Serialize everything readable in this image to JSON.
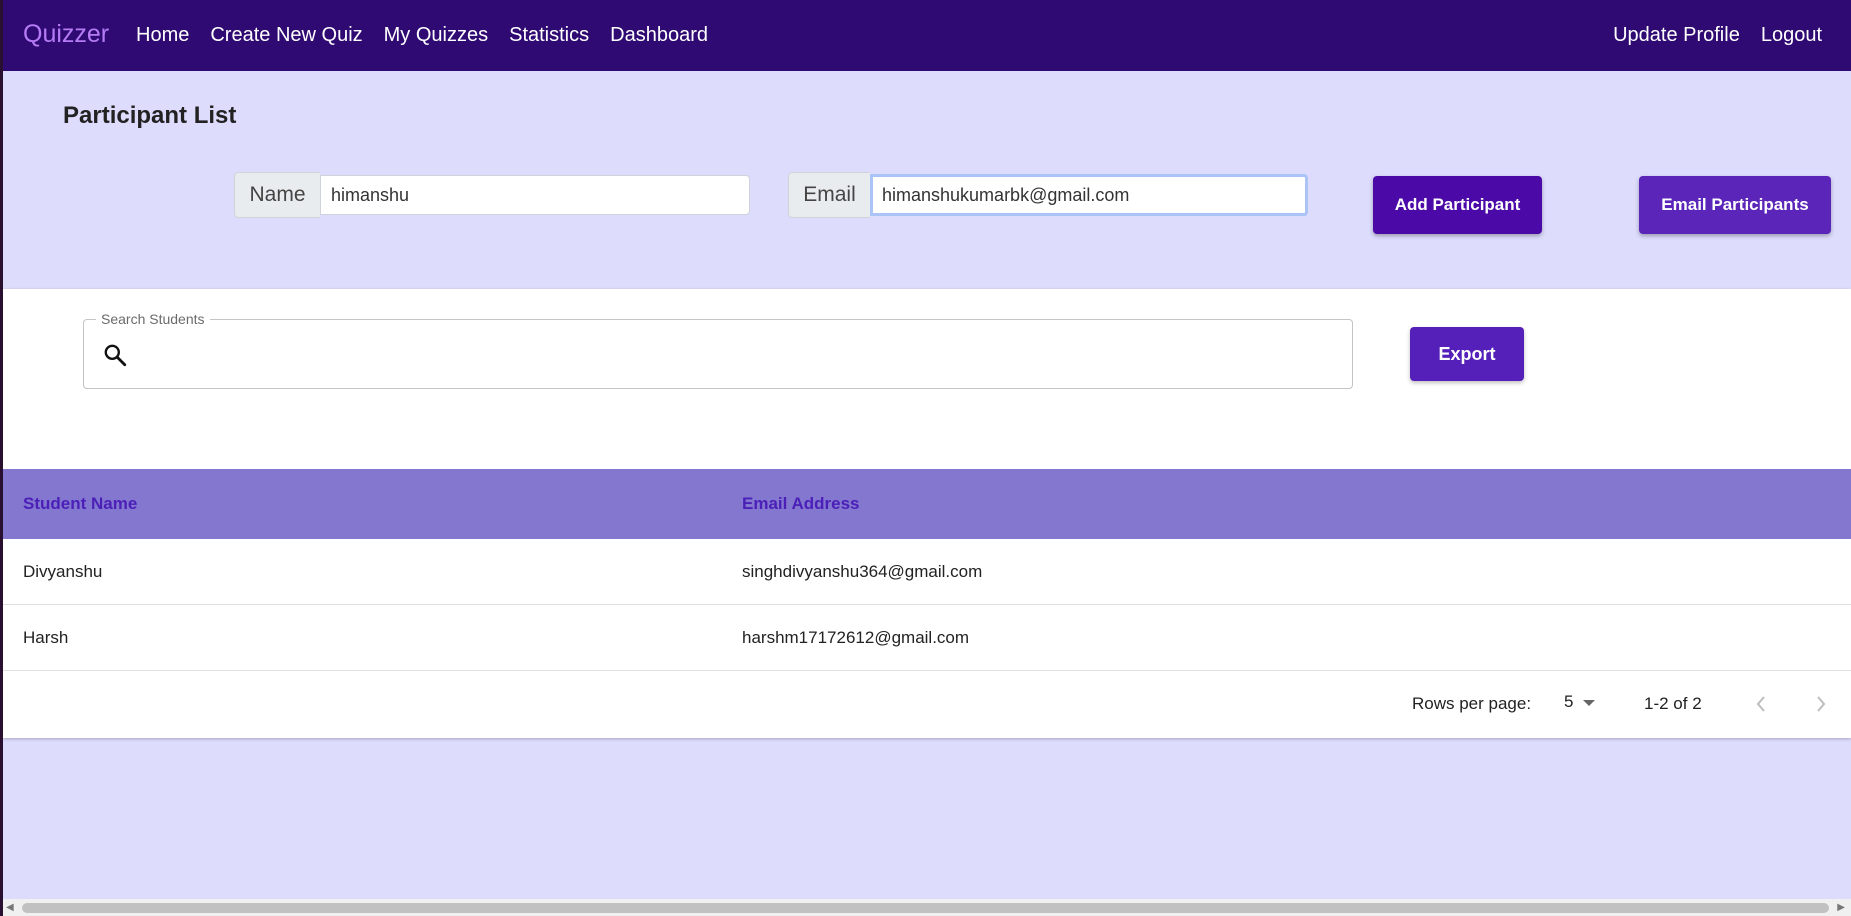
{
  "navbar": {
    "brand": "Quizzer",
    "links": [
      "Home",
      "Create New Quiz",
      "My Quizzes",
      "Statistics",
      "Dashboard"
    ],
    "right_links": [
      "Update Profile",
      "Logout"
    ]
  },
  "page": {
    "title": "Participant List"
  },
  "form": {
    "name_label": "Name",
    "name_value": "himanshu",
    "email_label": "Email",
    "email_value": "himanshukumarbk@gmail.com",
    "add_button": "Add Participant",
    "email_button": "Email Participants"
  },
  "search": {
    "label": "Search Students",
    "value": "",
    "icon": "search-icon"
  },
  "export_button": "Export",
  "table": {
    "headers": [
      "Student Name",
      "Email Address"
    ],
    "rows": [
      [
        "Divyanshu",
        "singhdivyanshu364@gmail.com"
      ],
      [
        "Harsh",
        "harshm17172612@gmail.com"
      ]
    ]
  },
  "pagination": {
    "rows_per_page_label": "Rows per page:",
    "rows_per_page": "5",
    "range": "1-2 of 2"
  },
  "colors": {
    "navbar": "#2f0a72",
    "brand": "#b57cf5",
    "background": "#dddcfd",
    "primary_button": "#4b0aa8",
    "table_header": "#8377cf",
    "table_header_text": "#4b1fb8"
  }
}
